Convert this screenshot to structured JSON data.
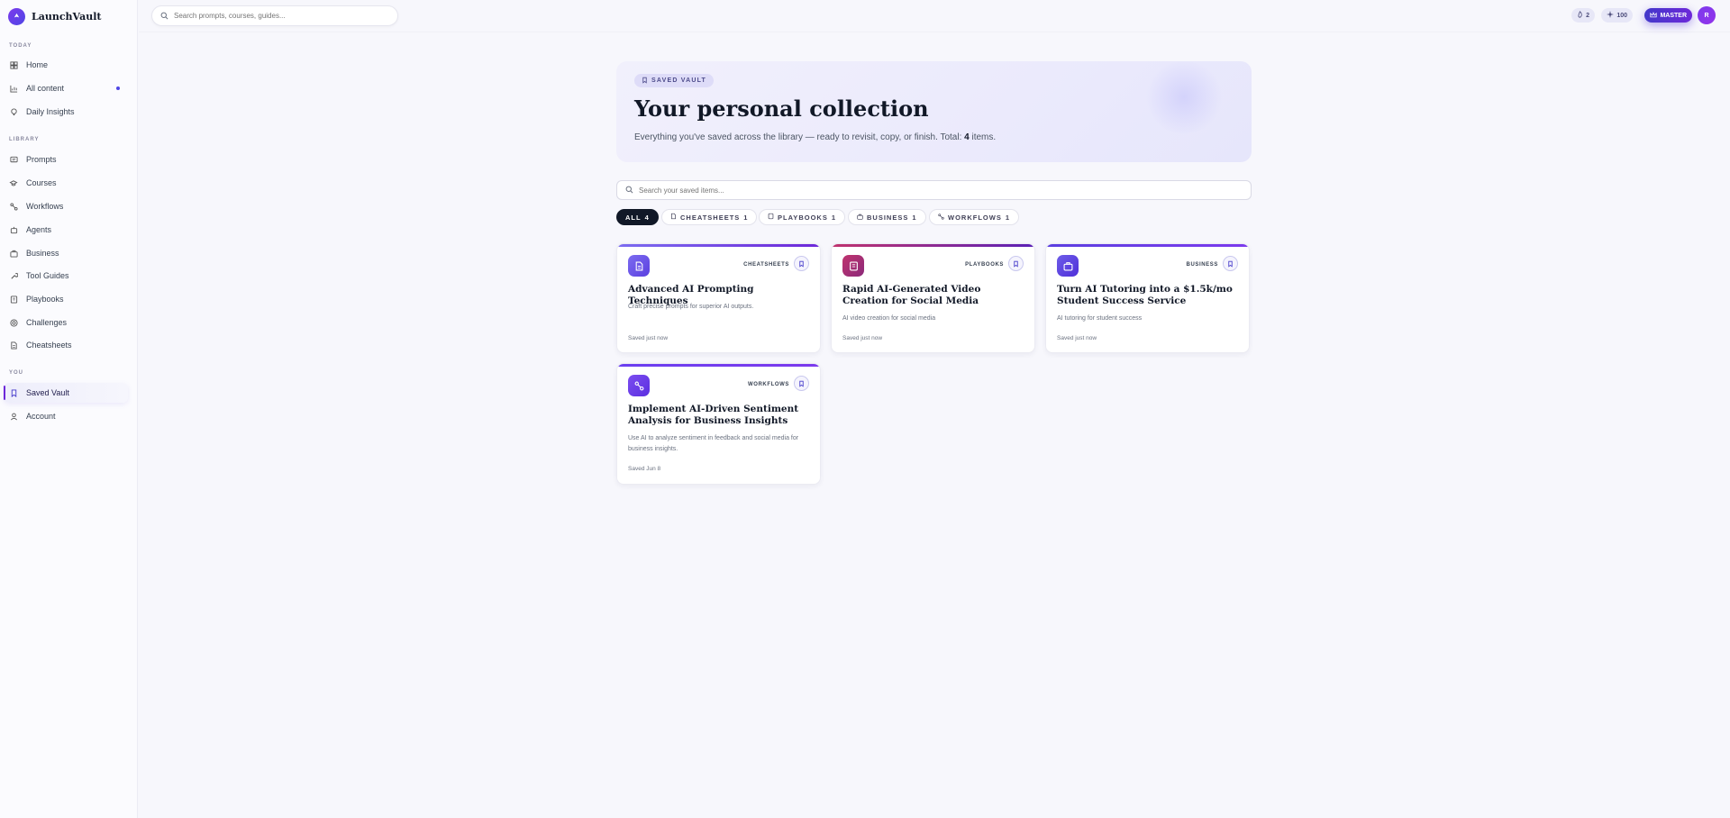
{
  "app": {
    "name": "LaunchVault"
  },
  "sidebar": {
    "sections": [
      {
        "label": "TODAY"
      },
      {
        "label": "LIBRARY"
      },
      {
        "label": "YOU"
      }
    ],
    "items": [
      {
        "label": "Home",
        "icon": "grid-icon"
      },
      {
        "label": "All content",
        "icon": "chart-icon"
      },
      {
        "label": "Daily Insights",
        "icon": "lightbulb-icon"
      },
      {
        "label": "Prompts",
        "icon": "message-icon"
      },
      {
        "label": "Courses",
        "icon": "graduation-cap-icon"
      },
      {
        "label": "Workflows",
        "icon": "route-icon"
      },
      {
        "label": "Agents",
        "icon": "bot-icon"
      },
      {
        "label": "Business",
        "icon": "briefcase-icon"
      },
      {
        "label": "Tool Guides",
        "icon": "wrench-icon"
      },
      {
        "label": "Playbooks",
        "icon": "book-icon"
      },
      {
        "label": "Challenges",
        "icon": "target-icon"
      },
      {
        "label": "Cheatsheets",
        "icon": "document-icon"
      },
      {
        "label": "Saved Vault",
        "icon": "bookmark-icon"
      },
      {
        "label": "Account",
        "icon": "user-icon"
      }
    ]
  },
  "topbar": {
    "search_placeholder": "Search prompts, courses, guides...",
    "streak": "2",
    "xp": "100",
    "level": "MASTER",
    "avatar_initial": "R"
  },
  "hero": {
    "badge": "SAVED VAULT",
    "title": "Your personal collection",
    "subtitle": "Everything you've saved across the library — ready to revisit, copy, or finish. Total:",
    "total": "4",
    "items_word": "items."
  },
  "vault_search": {
    "placeholder": "Search your saved items..."
  },
  "filters": [
    {
      "label": "ALL",
      "count": "4"
    },
    {
      "label": "CHEATSHEETS",
      "count": "1"
    },
    {
      "label": "PLAYBOOKS",
      "count": "1"
    },
    {
      "label": "BUSINESS",
      "count": "1"
    },
    {
      "label": "WORKFLOWS",
      "count": "1"
    }
  ],
  "cards": [
    {
      "category": "CHEATSHEETS",
      "title": "Advanced AI Prompting Techniques",
      "description": "Craft precise prompts for superior AI outputs.",
      "saved": "Saved just now",
      "icon": "document-icon",
      "accent": "#6d5ce8"
    },
    {
      "category": "PLAYBOOKS",
      "title": "Rapid AI-Generated Video Creation for Social Media",
      "description": "AI video creation for social media",
      "saved": "Saved just now",
      "icon": "book-icon",
      "accent": "#b8326e"
    },
    {
      "category": "BUSINESS",
      "title": "Turn AI Tutoring into a $1.5k/mo Student Success Service",
      "description": "AI tutoring for student success",
      "saved": "Saved just now",
      "icon": "briefcase-icon",
      "accent": "#5b3fe0"
    },
    {
      "category": "WORKFLOWS",
      "title": "Implement AI-Driven Sentiment Analysis for Business Insights",
      "description": "Use AI to analyze sentiment in feedback and social media for business insights.",
      "saved": "Saved Jun 8",
      "icon": "route-icon",
      "accent": "#6a3ff0"
    }
  ]
}
